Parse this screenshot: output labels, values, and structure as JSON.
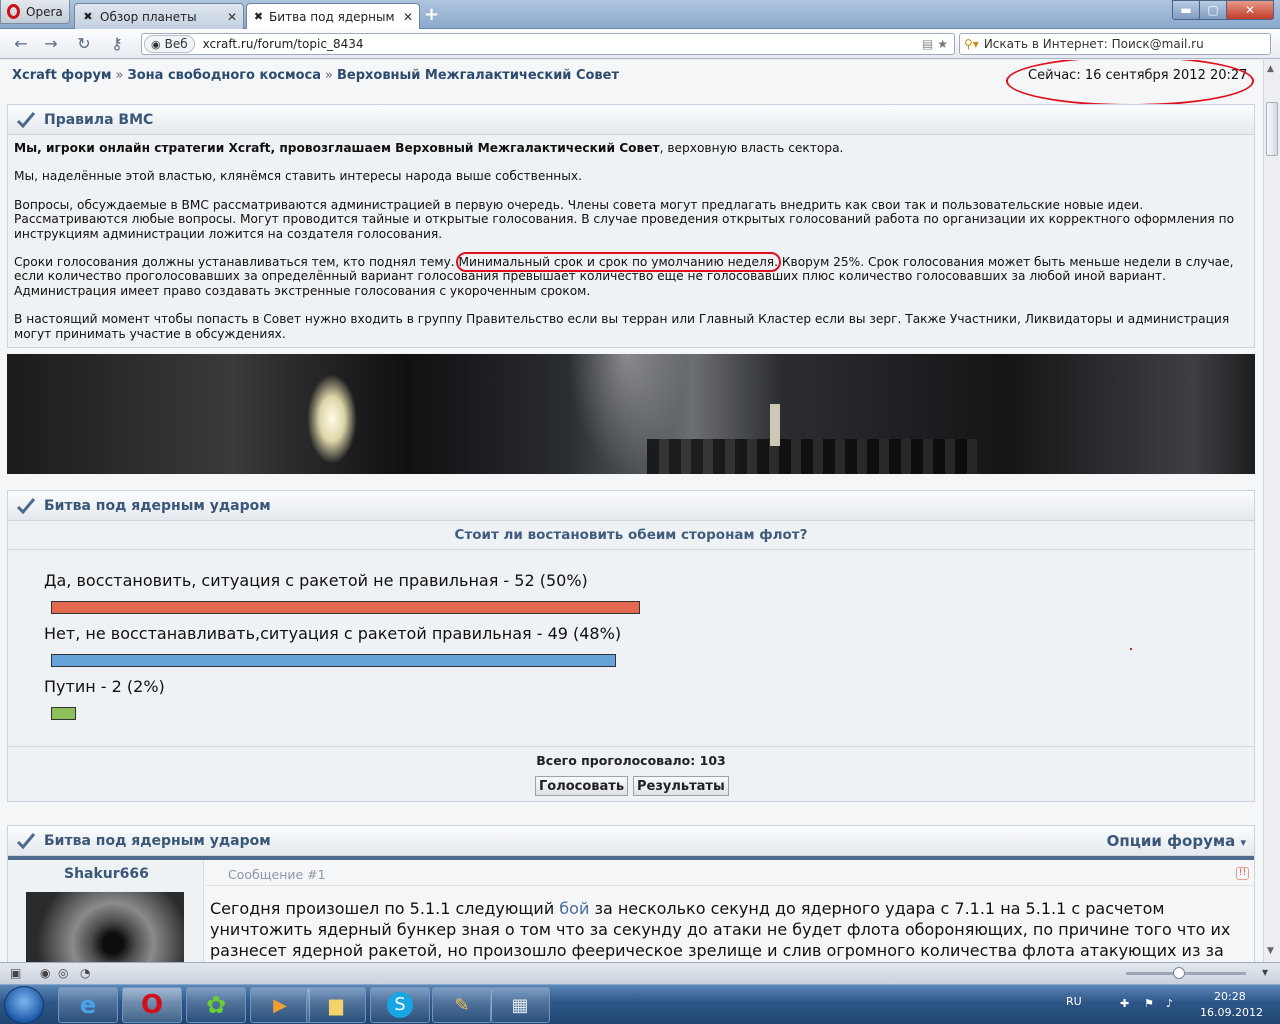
{
  "browser": {
    "menu_label": "Opera",
    "tabs": [
      {
        "label": "Обзор планеты"
      },
      {
        "label": "Битва под ядерным уда..."
      }
    ],
    "web_chip": "Веб",
    "url": "xcraft.ru/forum/topic_8434",
    "search_placeholder": "Искать в Интернет: Поиск@mail.ru"
  },
  "breadcrumb": {
    "items": [
      "Xcraft форум",
      "Зона свободного космоса",
      "Верховный Межгалактический Совет"
    ],
    "separator": "»"
  },
  "clock": "Сейчас: 16 сентября 2012 20:27",
  "rules": {
    "title": "Правила ВМС",
    "p1_bold": "Мы, игроки онлайн стратегии Xcraft, провозглашаем Верховный Межгалактический Совет",
    "p1_rest": ", верховную власть сектора.",
    "p2": "Мы, наделённые этой властью, клянёмся ставить интересы народа выше собственных.",
    "p3": "Вопросы, обсуждаемые в ВМС рассматриваются администрацией в первую очередь. Члены совета могут предлагать внедрить как свои так и пользовательские новые идеи. Рассматриваются любые вопросы. Могут проводится тайные и открытые голосования. В случае проведения открытых голосований работа по организации их корректного оформления по инструкциям администрации ложится на создателя голосования.",
    "p4_before": "Сроки голосования должны устанавливаться тем, кто поднял тему. ",
    "p4_highlight": "Минимальный срок и срок по умолчанию неделя.",
    "p4_after": " Кворум 25%. Срок голосования может быть меньше недели в случае, если количество проголосовавших за определённый вариант голосования превышает количество еще не голосовавших плюс количество голосовавших за любой иной вариант. Администрация имеет право создавать экстренные голосования с укороченным сроком.",
    "p5": "В настоящий момент чтобы попасть в Совет нужно входить в группу Правительство если вы терран или Главный Кластер если вы зерг. Также Участники, Ликвидаторы и администрация могут принимать участие в обсуждениях."
  },
  "poll": {
    "title": "Битва под ядерным ударом",
    "question": "Стоит ли востановить обеим сторонам флот?",
    "options": [
      {
        "label": "Да, восстановить, ситуация с ракетой не правильная - 52 (50%)",
        "percent": 50,
        "color": "#e2684f"
      },
      {
        "label": "Нет, не восстанавливать,ситуация с ракетой правильная - 49 (48%)",
        "percent": 48,
        "color": "#66a3d8"
      },
      {
        "label": "Путин - 2 (2%)",
        "percent": 2,
        "color": "#8cc15a"
      }
    ],
    "total": "Всего проголосовало: 103",
    "vote_button": "Голосовать",
    "results_button": "Результаты"
  },
  "topic": {
    "title": "Битва под ядерным ударом",
    "options_label": "Опции форума",
    "author": "Shakur666",
    "message_number": "Сообщение #1",
    "message_before_link": "Сегодня произошел по 5.1.1 следующий ",
    "message_link": "бой",
    "message_after_link": " за несколько секунд до ядерного удара с 7.1.1 на 5.1.1 с расчетом уничтожить ядерный бункер зная о том что за секунду до атаки не будет флота обороняющих, по причине того что их разнесет ядерной ракетой, но произошло феерическое зрелище и слив огромного количества флота атакующих из за"
  },
  "taskbar": {
    "lang": "RU",
    "time": "20:28",
    "date": "16.09.2012"
  }
}
